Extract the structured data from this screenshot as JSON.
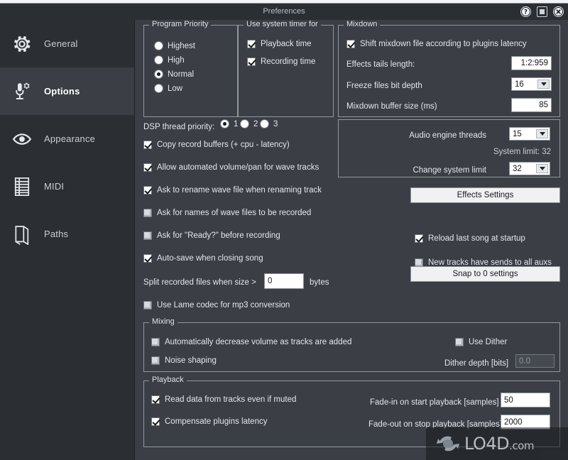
{
  "window": {
    "title": "Preferences",
    "buttons": [
      {
        "name": "help-button",
        "glyph": "?"
      },
      {
        "name": "maximize-button",
        "glyph": "■"
      },
      {
        "name": "close-button",
        "glyph": "✕"
      }
    ]
  },
  "sidebar": {
    "items": [
      {
        "label": "General",
        "icon": "gear-icon",
        "active": false
      },
      {
        "label": "Options",
        "icon": "microphone-settings-icon",
        "active": true
      },
      {
        "label": "Appearance",
        "icon": "eye-icon",
        "active": false
      },
      {
        "label": "MIDI",
        "icon": "midi-list-icon",
        "active": false
      },
      {
        "label": "Paths",
        "icon": "book-icon",
        "active": false
      }
    ]
  },
  "program_priority": {
    "legend": "Program Priority",
    "options": [
      "Highest",
      "High",
      "Normal",
      "Low"
    ],
    "selected": "Normal"
  },
  "system_timer": {
    "legend": "Use system timer for",
    "playback_time": {
      "label": "Playback time",
      "checked": true
    },
    "recording_time": {
      "label": "Recording time",
      "checked": true
    }
  },
  "mixdown": {
    "legend": "Mixdown",
    "shift_mixdown": {
      "label": "Shift mixdown file according to plugins latency",
      "checked": true
    },
    "effects_tails_label": "Effects tails length:",
    "effects_tails_value": "1:2:959",
    "freeze_bit_depth_label": "Freeze files bit depth",
    "freeze_bit_depth_value": "16",
    "mixdown_buffer_label": "Mixdown buffer size (ms)",
    "mixdown_buffer_value": "85"
  },
  "engine": {
    "audio_engine_threads_label": "Audio engine threads",
    "audio_engine_threads_value": "15",
    "system_limit_label": "System limit: 32",
    "change_system_limit_label": "Change system limit",
    "change_system_limit_value": "32"
  },
  "dsp": {
    "label": "DSP thread priority:",
    "options": [
      "1",
      "2",
      "3"
    ],
    "selected": "1"
  },
  "options_checks": [
    {
      "label": "Copy record buffers (+ cpu - latency)",
      "checked": true
    },
    {
      "label": "Allow automated volume/pan for wave tracks",
      "checked": true
    },
    {
      "label": "Ask to rename wave file when renaming track",
      "checked": true
    },
    {
      "label": "Ask for names of wave files to be recorded",
      "checked": false
    },
    {
      "label": "Ask for \"Ready?\" before recording",
      "checked": false
    },
    {
      "label": "Auto-save when closing song",
      "checked": true
    }
  ],
  "split": {
    "label": "Split recorded files when size >",
    "value": "0",
    "unit": "bytes"
  },
  "lame": {
    "label": "Use Lame codec for mp3 conversion",
    "checked": false
  },
  "right_column": {
    "effects_settings_button": "Effects Settings",
    "reload_last_song": {
      "label": "Reload last song at startup",
      "checked": true
    },
    "new_tracks_sends": {
      "label": "New tracks have sends to all auxs",
      "checked": false
    },
    "snap_button": "Snap to 0 settings"
  },
  "mixing": {
    "legend": "Mixing",
    "auto_decrease": {
      "label": "Automatically decrease volume as tracks are added",
      "checked": false
    },
    "noise_shaping": {
      "label": "Noise shaping",
      "checked": false
    },
    "use_dither": {
      "label": "Use Dither",
      "checked": false
    },
    "dither_depth_label": "Dither depth [bits]",
    "dither_depth_value": "0.0"
  },
  "playback": {
    "legend": "Playback",
    "read_muted": {
      "label": "Read data from tracks even if muted",
      "checked": true
    },
    "compensate_latency": {
      "label": "Compensate plugins latency",
      "checked": true
    },
    "fade_in_label": "Fade-in on start playback [samples]",
    "fade_in_value": "50",
    "fade_out_label": "Fade-out on stop playback [samples]",
    "fade_out_value": "2000"
  },
  "watermark": {
    "text": "LO4D",
    "suffix": ".com"
  }
}
